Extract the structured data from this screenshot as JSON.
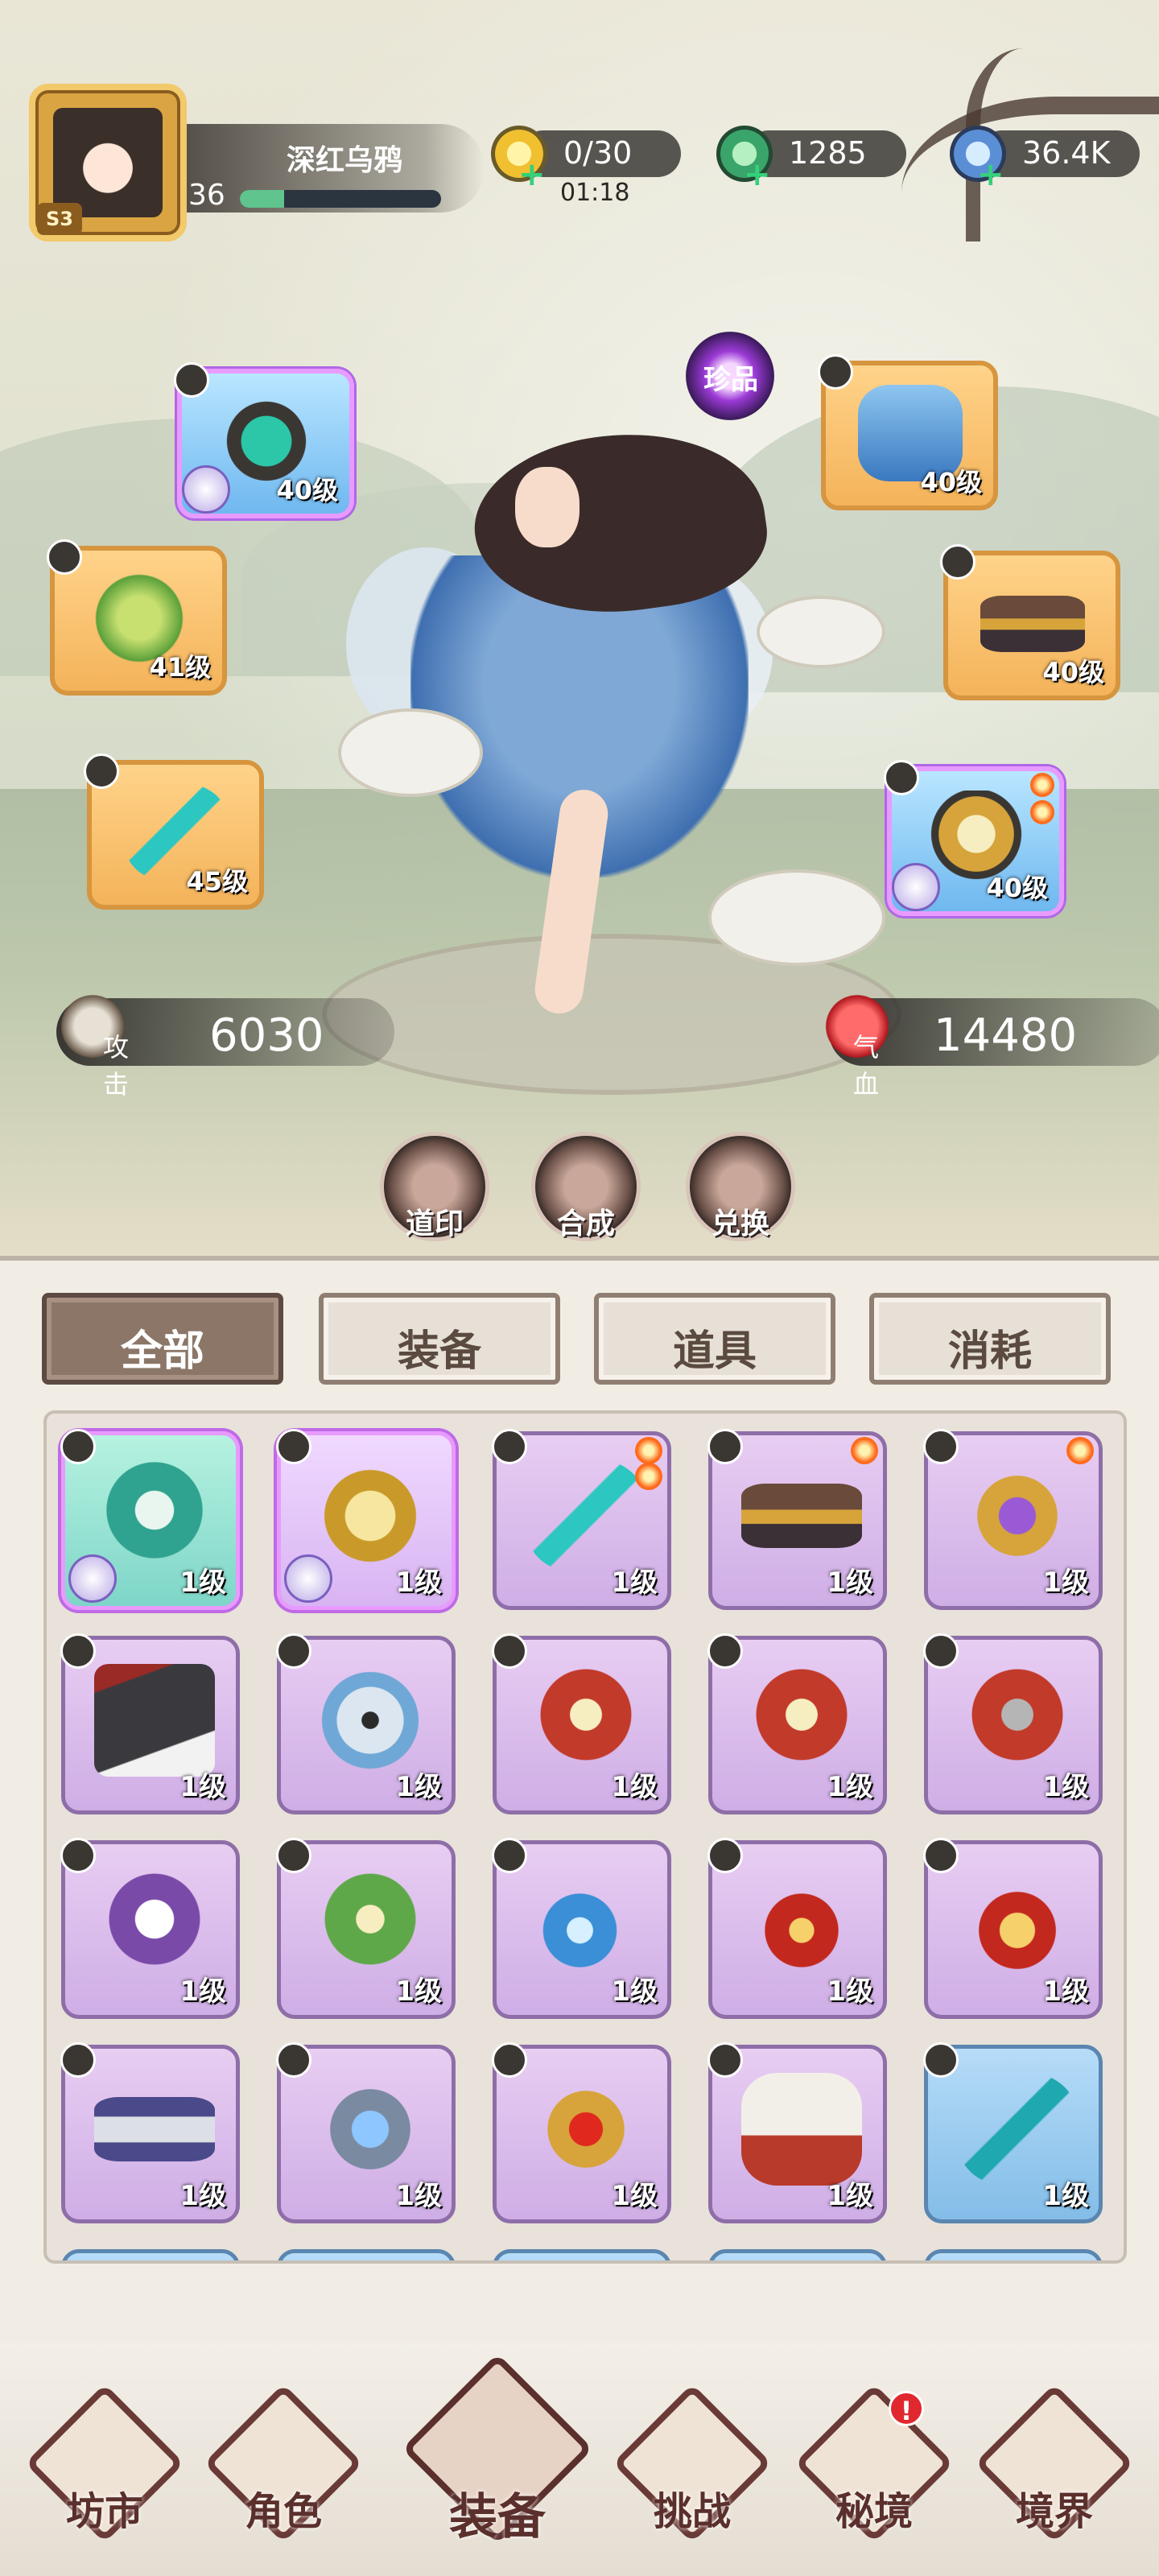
{
  "player": {
    "name": "深红乌鸦",
    "level": "36",
    "season": "S3",
    "exp_fraction": 0.22
  },
  "resources": {
    "energy": {
      "value": "0/30",
      "timer": "01:18",
      "icon": "lightning-icon"
    },
    "jade": {
      "value": "1285",
      "icon": "jade-icon"
    },
    "crystal": {
      "value": "36.4K",
      "icon": "crystal-icon"
    }
  },
  "treasure": {
    "label": "珍品"
  },
  "equipped": [
    {
      "slot": "ring",
      "level": "40级",
      "rare": true
    },
    {
      "slot": "boots",
      "level": "40级",
      "rare": false
    },
    {
      "slot": "gourd",
      "level": "41级",
      "rare": false
    },
    {
      "slot": "belt",
      "level": "40级",
      "rare": false
    },
    {
      "slot": "weapon",
      "level": "45级",
      "rare": false
    },
    {
      "slot": "armor",
      "level": "40级",
      "rare": true
    }
  ],
  "stats": {
    "attack": {
      "label": "攻击",
      "value": "6030"
    },
    "hp": {
      "label": "气血",
      "value": "14480"
    }
  },
  "actions": [
    {
      "label": "道印"
    },
    {
      "label": "合成"
    },
    {
      "label": "兑换"
    }
  ],
  "tabs": [
    {
      "label": "全部",
      "active": true
    },
    {
      "label": "装备",
      "active": false
    },
    {
      "label": "道具",
      "active": false
    },
    {
      "label": "消耗",
      "active": false
    }
  ],
  "inventory": [
    {
      "name": "jade-armor",
      "level": "1级"
    },
    {
      "name": "gold-ring",
      "level": "1级"
    },
    {
      "name": "jade-sword",
      "level": "1级"
    },
    {
      "name": "ornate-belt",
      "level": "1级"
    },
    {
      "name": "amethyst-ring",
      "level": "1级"
    },
    {
      "name": "cleaver",
      "level": "1级"
    },
    {
      "name": "taiji-robe",
      "level": "1级"
    },
    {
      "name": "red-robe",
      "level": "1级"
    },
    {
      "name": "red-robe-2",
      "level": "1级"
    },
    {
      "name": "red-armor",
      "level": "1级"
    },
    {
      "name": "fur-robe",
      "level": "1级"
    },
    {
      "name": "green-robe",
      "level": "1级"
    },
    {
      "name": "blue-pendant",
      "level": "1级"
    },
    {
      "name": "red-pendant",
      "level": "1级"
    },
    {
      "name": "gold-pendant",
      "level": "1级"
    },
    {
      "name": "taiji-belt",
      "level": "1级"
    },
    {
      "name": "sapphire-ring",
      "level": "1级"
    },
    {
      "name": "ruby-ring",
      "level": "1级"
    },
    {
      "name": "red-boots",
      "level": "1级"
    },
    {
      "name": "blue-sword",
      "level": "1级"
    }
  ],
  "nav": [
    {
      "label": "坊市",
      "icon": "market-icon",
      "active": false
    },
    {
      "label": "角色",
      "icon": "character-icon",
      "active": false
    },
    {
      "label": "装备",
      "icon": "equipment-icon",
      "active": true
    },
    {
      "label": "挑战",
      "icon": "crossed-swords-icon",
      "active": false
    },
    {
      "label": "秘境",
      "icon": "pagoda-icon",
      "active": false,
      "badge": "!"
    },
    {
      "label": "境界",
      "icon": "realm-icon",
      "active": false
    }
  ],
  "colors": {
    "accent": "#8b7668",
    "rare_border": "#c06ae6",
    "item_purple": "#cfaee6",
    "item_blue": "#83bde8",
    "nav_dark": "#5a2f2c"
  }
}
